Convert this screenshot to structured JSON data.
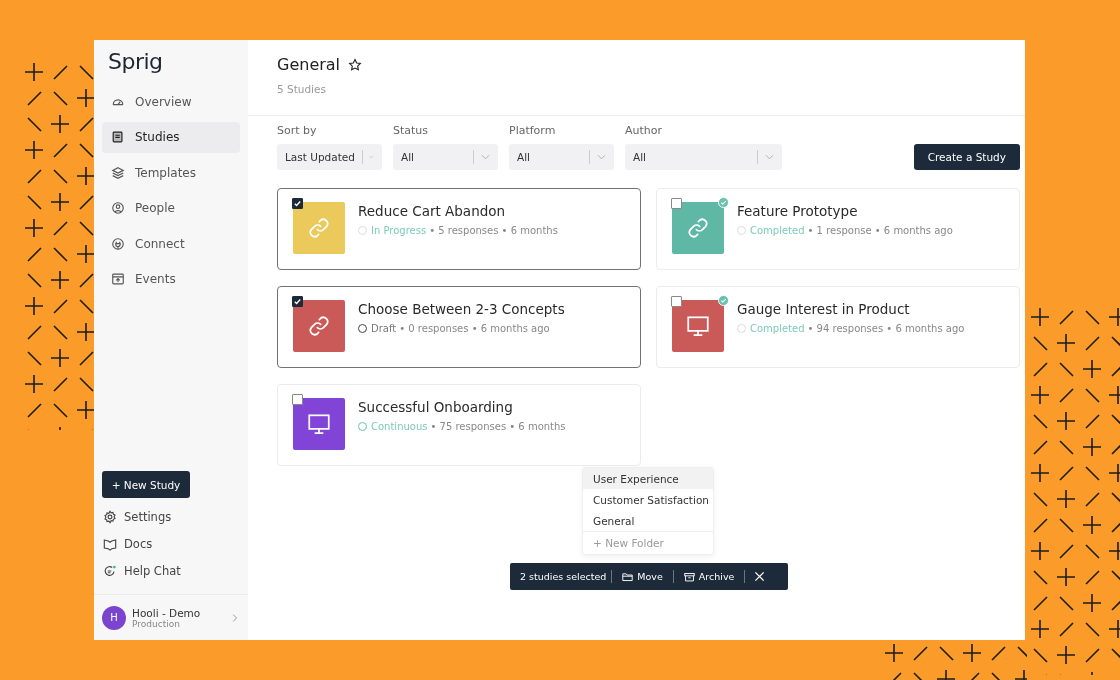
{
  "sidebar": {
    "logo": "Sprig",
    "items": [
      {
        "label": "Overview",
        "kind": "gauge",
        "selected": false
      },
      {
        "label": "Studies",
        "kind": "book",
        "selected": true
      },
      {
        "label": "Templates",
        "kind": "layers",
        "selected": false
      },
      {
        "label": "People",
        "kind": "person",
        "selected": false
      },
      {
        "label": "Connect",
        "kind": "plug",
        "selected": false
      },
      {
        "label": "Events",
        "kind": "calendar",
        "selected": false
      }
    ],
    "new_button": "+ New Study",
    "bottom_items": [
      {
        "label": "Settings",
        "kind": "gear"
      },
      {
        "label": "Docs",
        "kind": "book-open"
      },
      {
        "label": "Help Chat",
        "kind": "chat"
      }
    ],
    "account": {
      "initial": "H",
      "name": "Hooli - Demo",
      "subtitle": "Production"
    }
  },
  "header": {
    "title": "General",
    "count": "5 Studies"
  },
  "filters": [
    {
      "label": "Sort by",
      "value": "Last Updated"
    },
    {
      "label": "Status",
      "value": "All"
    },
    {
      "label": "Platform",
      "value": "All"
    },
    {
      "label": "Author",
      "value": "All"
    }
  ],
  "create_button": "Create a Study",
  "studies": [
    {
      "title": "Reduce Cart Abandon",
      "kind": "link",
      "color": "#ebc95a",
      "checked": true,
      "completed_badge": false,
      "status": {
        "text": "In Progress",
        "kind": "active"
      },
      "details": "• 5 responses • 6 months"
    },
    {
      "title": "Feature Prototype",
      "kind": "link",
      "color": "#5fb8a5",
      "checked": false,
      "completed_badge": true,
      "status": {
        "text": "Completed",
        "kind": "active"
      },
      "details": "• 1 response • 6 months ago"
    },
    {
      "title": "Choose Between 2-3 Concepts",
      "kind": "link",
      "color": "#c95a57",
      "checked": true,
      "completed_badge": false,
      "status": {
        "text": "Draft",
        "kind": "draft"
      },
      "details": "• 0 responses • 6 months ago"
    },
    {
      "title": "Gauge Interest in Product",
      "kind": "monitor",
      "color": "#c95a57",
      "checked": false,
      "completed_badge": true,
      "status": {
        "text": "Completed",
        "kind": "active"
      },
      "details": "• 94 responses • 6 months ago"
    },
    {
      "title": "Successful Onboarding",
      "kind": "monitor",
      "color": "#8144d6",
      "checked": false,
      "completed_badge": false,
      "status": {
        "text": "Continuous",
        "kind": "continuous"
      },
      "details": "• 75 responses • 6 months"
    }
  ],
  "folder_menu": {
    "items": [
      {
        "label": "User Experience",
        "selected": true
      },
      {
        "label": "Customer Satisfaction",
        "selected": false
      },
      {
        "label": "General",
        "selected": false
      }
    ],
    "new_folder": "+ New Folder"
  },
  "selection_bar": {
    "count": "2 studies selected",
    "move": "Move",
    "archive": "Archive"
  }
}
